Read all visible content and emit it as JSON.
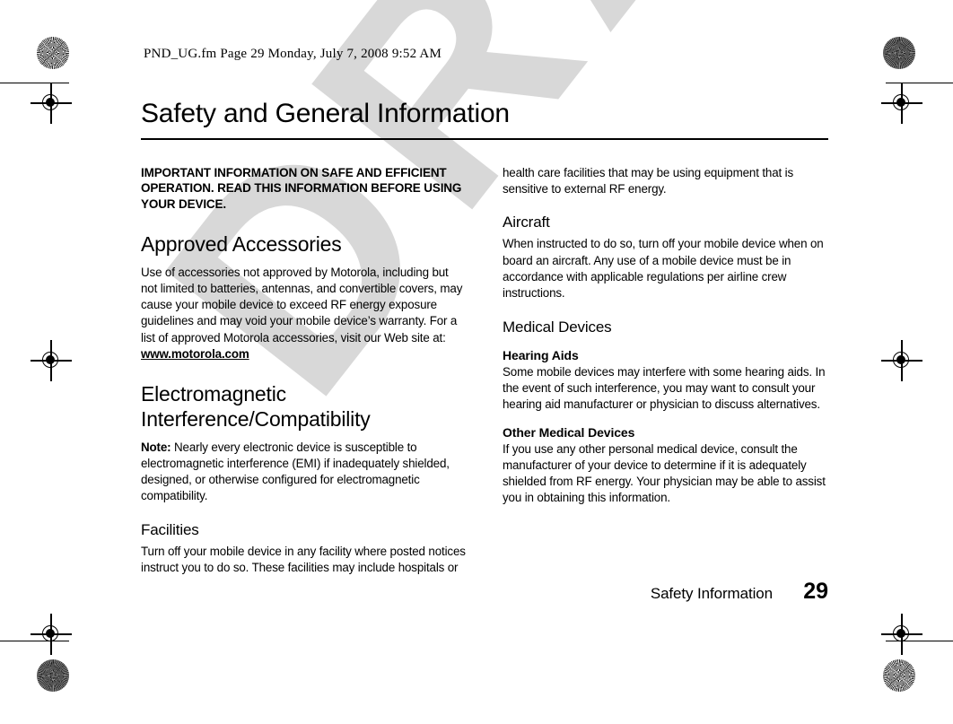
{
  "proof": {
    "fm_header": "PND_UG.fm  Page 29  Monday, July 7, 2008  9:52 AM",
    "watermark_text": "DRAFT",
    "watermark_color": "#d8d8d8"
  },
  "document": {
    "title": "Safety and General Information",
    "lead_paragraph": "IMPORTANT INFORMATION ON SAFE AND EFFICIENT OPERATION. READ THIS INFORMATION BEFORE USING YOUR DEVICE.",
    "left_column": {
      "sections": [
        {
          "heading": "Approved Accessories",
          "level": "h2",
          "paragraph_before_url": "Use of accessories not approved by Motorola, including but not limited to batteries, antennas, and convertible covers, may cause your mobile device to exceed RF energy exposure guidelines and may void your mobile device’s warranty. For a list of approved Motorola accessories, visit our Web site at: ",
          "url": "www.motorola.com"
        },
        {
          "heading": "Electromagnetic Interference/Compatibility",
          "level": "h2",
          "note_label": "Note:",
          "note_text": " Nearly every electronic device is susceptible to electromagnetic interference (EMI) if inadequately shielded, designed, or otherwise configured for electromagnetic compatibility."
        },
        {
          "heading": "Facilities",
          "level": "h3",
          "paragraph": "Turn off your mobile device in any facility where posted notices instruct you to do so. These facilities may include hospitals or"
        }
      ]
    },
    "right_column": {
      "continuation": "health care facilities that may be using equipment that is sensitive to external RF energy.",
      "sections": [
        {
          "heading": "Aircraft",
          "level": "h3",
          "paragraph": "When instructed to do so, turn off your mobile device when on board an aircraft. Any use of a mobile device must be in accordance with applicable regulations per airline crew instructions."
        },
        {
          "heading": "Medical Devices",
          "level": "h3",
          "subsections": [
            {
              "heading": "Hearing Aids",
              "paragraph": "Some mobile devices may interfere with some hearing aids. In the event of such interference, you may want to consult your hearing aid manufacturer or physician to discuss alternatives."
            },
            {
              "heading": "Other Medical Devices",
              "paragraph": "If you use any other personal medical device, consult the manufacturer of your device to determine if it is adequately shielded from RF energy. Your physician may be able to assist you in obtaining this information."
            }
          ]
        }
      ]
    },
    "footer": {
      "running_head": "Safety Information",
      "page_number": "29"
    }
  }
}
